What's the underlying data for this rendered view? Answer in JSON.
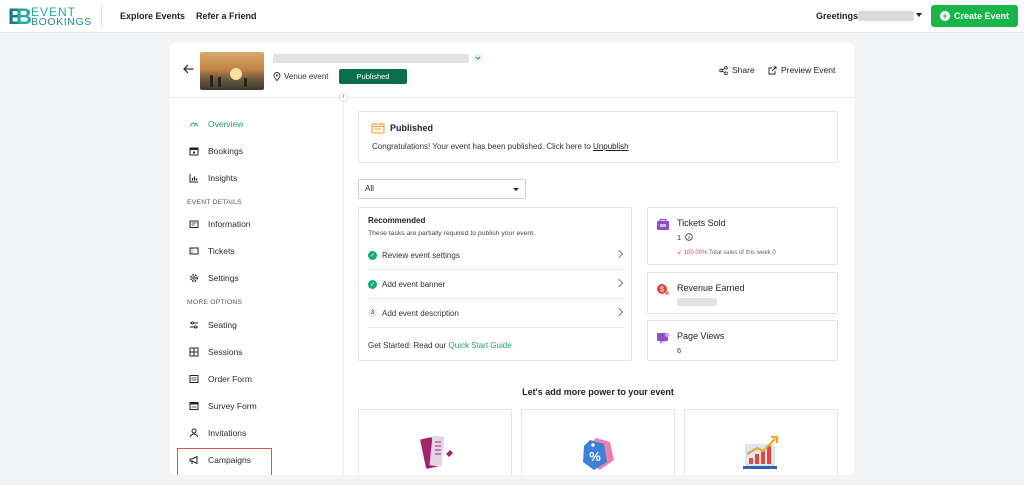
{
  "topbar": {
    "logo_line1": "EVENT",
    "logo_line2": "BOOKINGS",
    "nav": [
      "Explore Events",
      "Refer a Friend"
    ],
    "greeting": "Greetings!",
    "create_label": "Create Event"
  },
  "event": {
    "venue_label": "Venue event",
    "status": "Published",
    "share_label": "Share",
    "preview_label": "Preview Event"
  },
  "sidebar": {
    "items": [
      {
        "label": "Overview",
        "icon": "dashboard-gauge-icon"
      },
      {
        "label": "Bookings",
        "icon": "calendar-icon"
      },
      {
        "label": "Insights",
        "icon": "bar-chart-icon"
      },
      {
        "label": "Information",
        "icon": "info-card-icon"
      },
      {
        "label": "Tickets",
        "icon": "ticket-icon"
      },
      {
        "label": "Settings",
        "icon": "gear-icon"
      },
      {
        "label": "Seating",
        "icon": "sliders-icon"
      },
      {
        "label": "Sessions",
        "icon": "grid-icon"
      },
      {
        "label": "Order Form",
        "icon": "form-icon"
      },
      {
        "label": "Survey Form",
        "icon": "survey-icon"
      },
      {
        "label": "Invitations",
        "icon": "person-icon"
      },
      {
        "label": "Campaigns",
        "icon": "megaphone-icon"
      }
    ],
    "section_event_details": "EVENT DETAILS",
    "section_more_options": "MORE OPTIONS",
    "active_color": "#1f9a8a"
  },
  "published_banner": {
    "title": "Published",
    "message": "Congratulations! Your event has been published. Click here to",
    "link": "Unpublish"
  },
  "filter": {
    "selected": "All"
  },
  "recommended": {
    "title": "Recommended",
    "subtitle": "These tasks are partially required to publish your event.",
    "tasks": [
      {
        "label": "Review event settings",
        "state": "done"
      },
      {
        "label": "Add event banner",
        "state": "done"
      },
      {
        "label": "Add event description",
        "state": "3"
      }
    ],
    "guide_prefix": "Get Started: Read our",
    "guide_link": "Quick Start Guide"
  },
  "stats": {
    "tickets_sold": {
      "label": "Tickets Sold",
      "value": "1",
      "pct": "100.00%",
      "note": "Total sales of this week 0"
    },
    "revenue": {
      "label": "Revenue Earned"
    },
    "page_views": {
      "label": "Page Views",
      "value": "6"
    }
  },
  "power": {
    "title": "Let's add more power to your event"
  },
  "colors": {
    "brand_green": "#18b548",
    "published_badge": "#0b6e4f",
    "accent_teal": "#1f9a8a",
    "highlight_red": "#d9534f"
  }
}
